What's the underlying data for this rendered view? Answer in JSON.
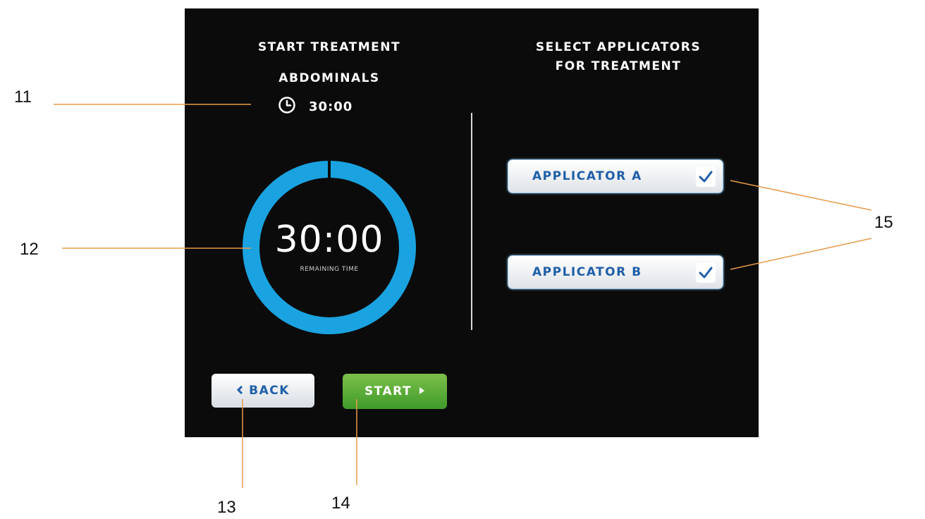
{
  "left_panel": {
    "title": "START TREATMENT",
    "region": "ABDOMINALS",
    "duration": "30:00",
    "clock_icon": "clock-icon"
  },
  "timer": {
    "time": "30:00",
    "label": "REMAINING TIME",
    "progress": 1.0,
    "ring_color": "#1aa3e0"
  },
  "right_panel": {
    "title_line1": "SELECT APPLICATORS",
    "title_line2": "FOR TREATMENT",
    "applicators": [
      {
        "label": "APPLICATOR A",
        "checked": true
      },
      {
        "label": "APPLICATOR B",
        "checked": true
      }
    ]
  },
  "buttons": {
    "back": "BACK",
    "start": "START"
  },
  "colors": {
    "accent_blue": "#1f5fa8",
    "start_green": "#4fa832",
    "screen_bg": "#0b0b0b",
    "callout_line": "#e89a4a"
  },
  "callouts": [
    "11",
    "12",
    "13",
    "14",
    "15"
  ]
}
